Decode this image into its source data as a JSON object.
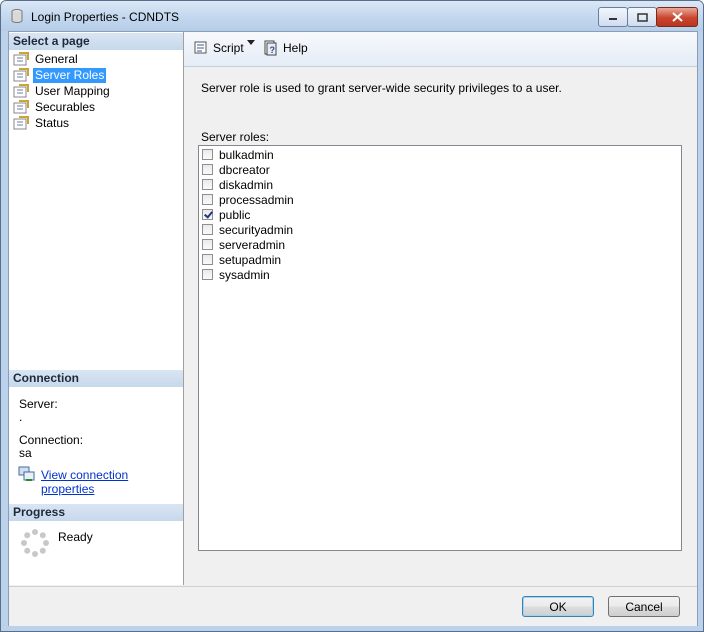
{
  "window": {
    "title": "Login Properties - CDNDTS"
  },
  "left": {
    "select_header": "Select a page",
    "pages": [
      {
        "label": "General",
        "selected": false
      },
      {
        "label": "Server Roles",
        "selected": true
      },
      {
        "label": "User Mapping",
        "selected": false
      },
      {
        "label": "Securables",
        "selected": false
      },
      {
        "label": "Status",
        "selected": false
      }
    ],
    "connection_header": "Connection",
    "server_label": "Server:",
    "server_value": ".",
    "connection_label": "Connection:",
    "connection_value": "sa",
    "view_link": "View connection properties",
    "progress_header": "Progress",
    "progress_status": "Ready"
  },
  "toolbar": {
    "script_label": "Script",
    "help_label": "Help"
  },
  "content": {
    "description": "Server role is used to grant server-wide security privileges to a user.",
    "roles_label": "Server roles:",
    "roles": [
      {
        "name": "bulkadmin",
        "checked": false
      },
      {
        "name": "dbcreator",
        "checked": false
      },
      {
        "name": "diskadmin",
        "checked": false
      },
      {
        "name": "processadmin",
        "checked": false
      },
      {
        "name": "public",
        "checked": true
      },
      {
        "name": "securityadmin",
        "checked": false
      },
      {
        "name": "serveradmin",
        "checked": false
      },
      {
        "name": "setupadmin",
        "checked": false
      },
      {
        "name": "sysadmin",
        "checked": false
      }
    ]
  },
  "buttons": {
    "ok": "OK",
    "cancel": "Cancel"
  }
}
